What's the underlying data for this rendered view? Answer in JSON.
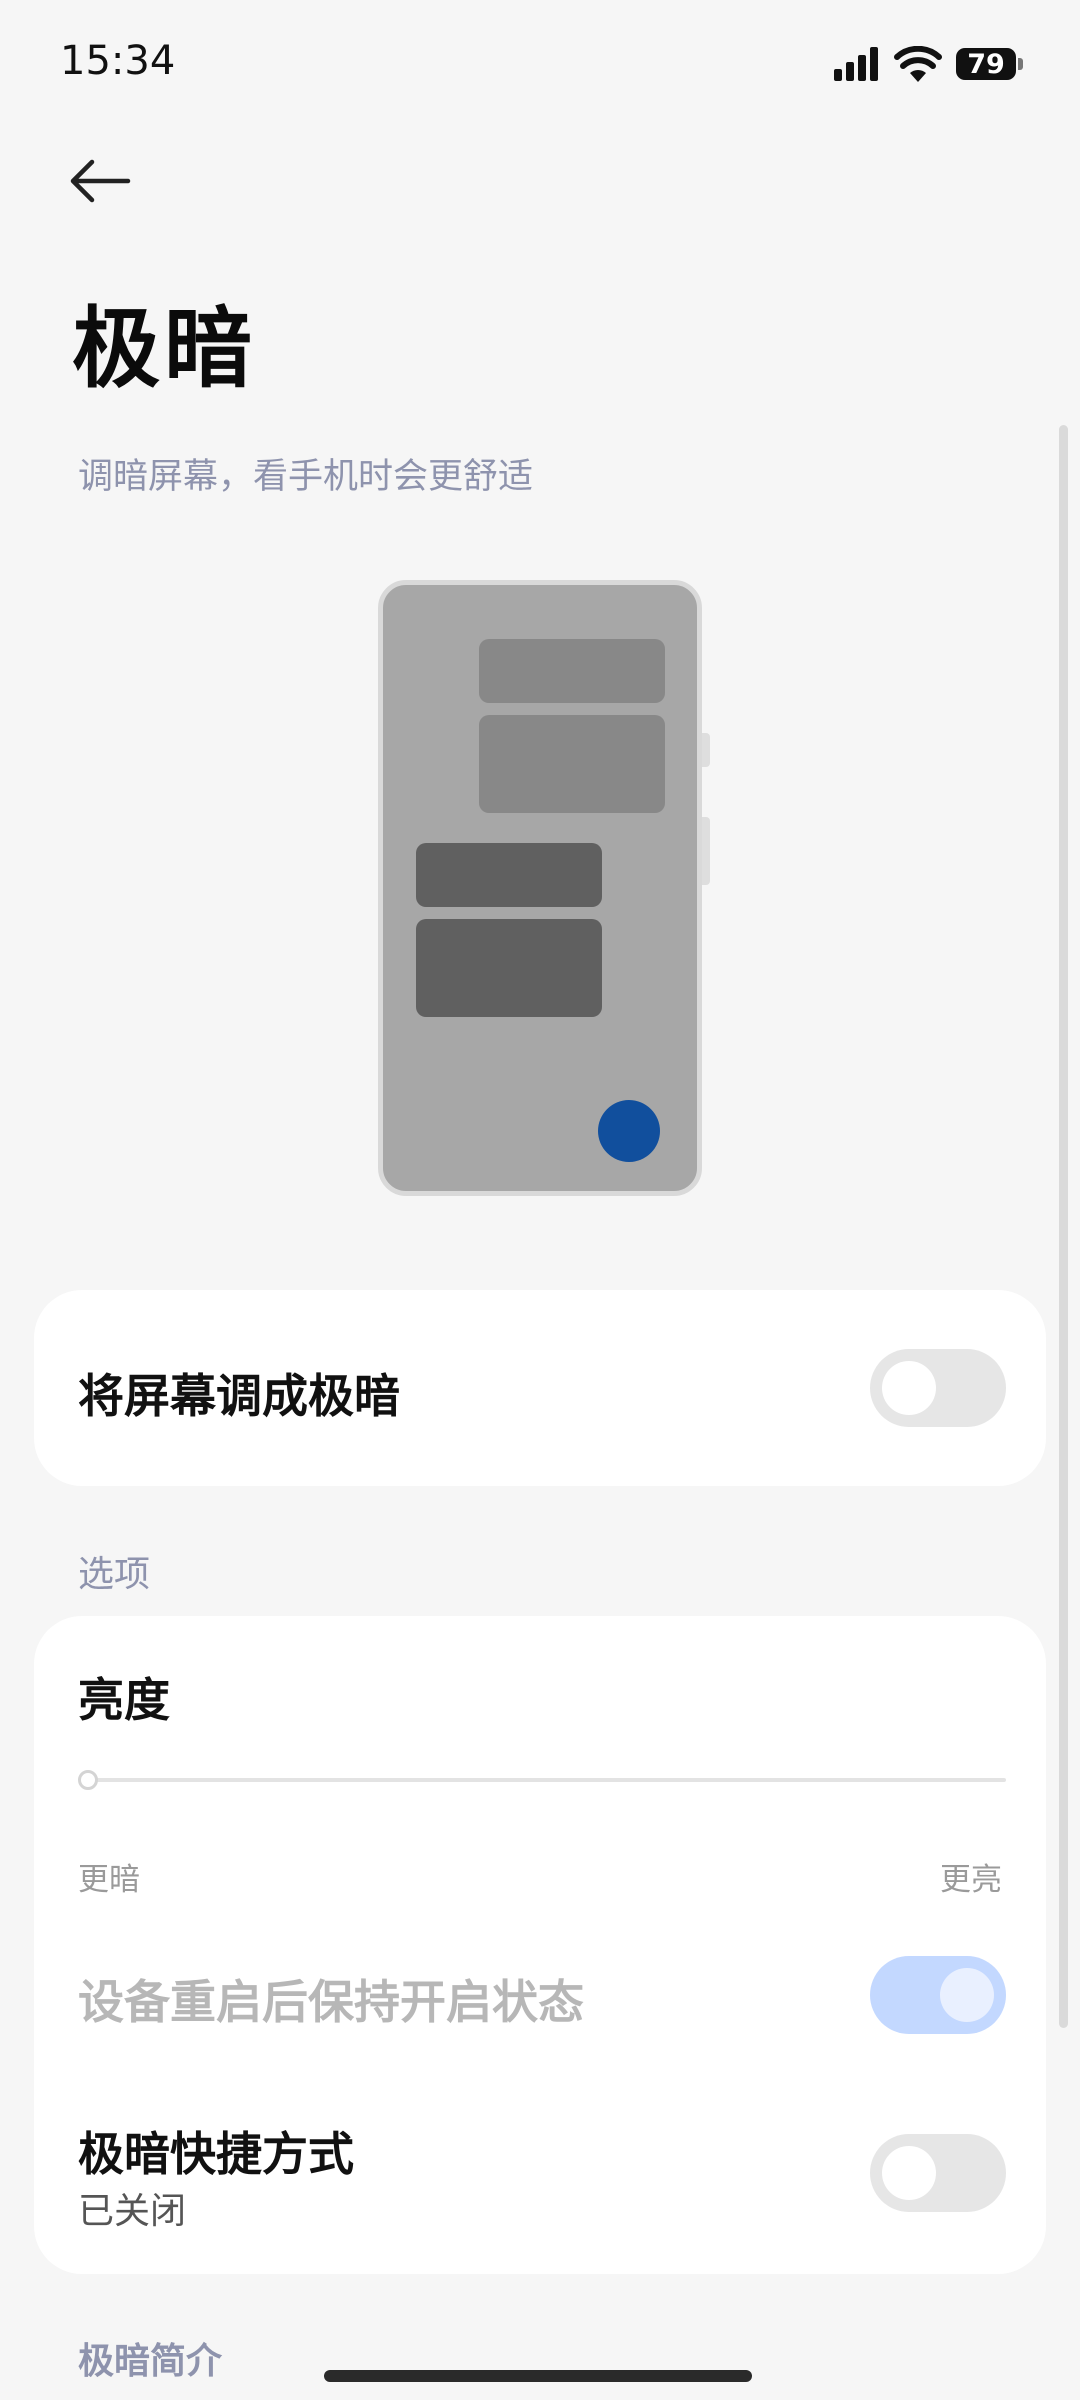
{
  "status_bar": {
    "time": "15:34",
    "battery": "79"
  },
  "header": {
    "title": "极暗",
    "subtitle": "调暗屏幕，看手机时会更舒适"
  },
  "main_toggle": {
    "label": "将屏幕调成极暗",
    "on": false
  },
  "options": {
    "section_label": "选项",
    "brightness": {
      "label": "亮度",
      "min_label": "更暗",
      "max_label": "更亮",
      "value_fraction": 0.0
    },
    "keep_after_restart": {
      "label": "设备重启后保持开启状态",
      "on": true,
      "disabled": true
    },
    "shortcut": {
      "label": "极暗快捷方式",
      "status": "已关闭",
      "on": false
    }
  },
  "intro_section_label": "极暗简介",
  "colors": {
    "accent_disabled": "#c3d8ff",
    "preview_dot": "#114f9d",
    "secondary_text": "#8e93ad"
  }
}
